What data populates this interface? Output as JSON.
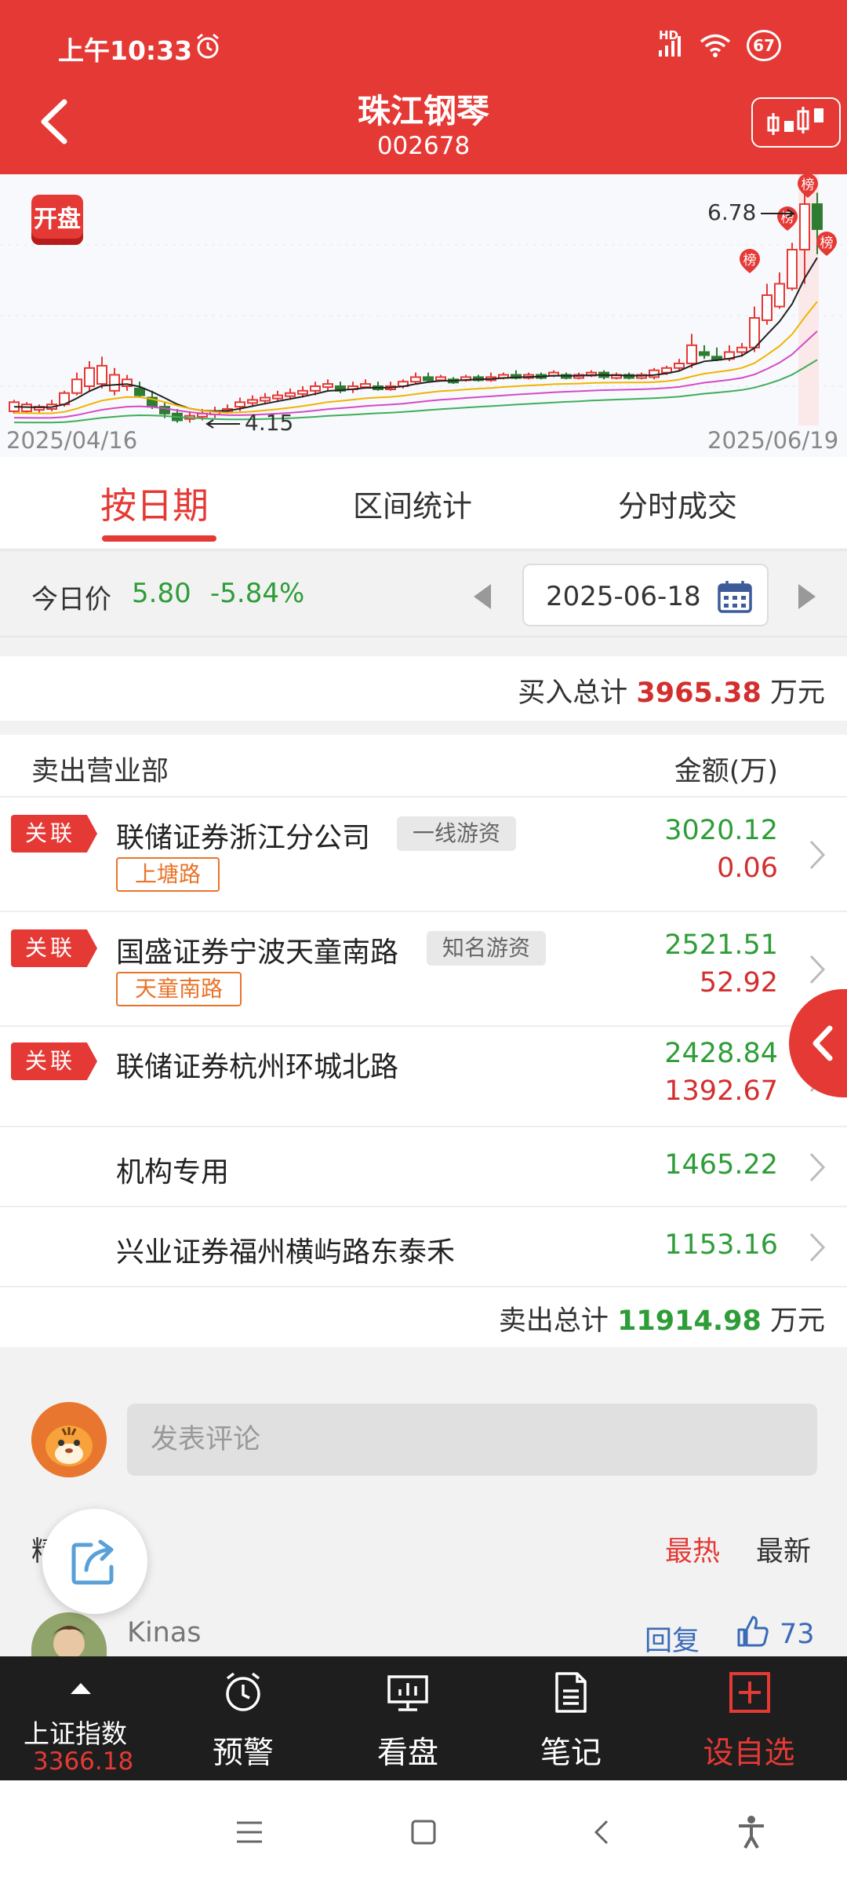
{
  "status_bar": {
    "time": "上午10:33",
    "network": "HD",
    "battery": "67"
  },
  "header": {
    "title": "珠江钢琴",
    "code": "002678"
  },
  "chart": {
    "logo": "开盘",
    "start_date": "2025/04/16",
    "end_date": "2025/06/19",
    "high_label": "6.78",
    "low_label": "4.15",
    "marker_label": "榜",
    "colors": {
      "up": "#e53935",
      "down": "#2e7d32",
      "ma5": "#222222",
      "ma10": "#f0b400",
      "ma20": "#d44ac7",
      "ma60": "#3fae5a"
    }
  },
  "tabs": [
    {
      "label": "按日期",
      "active": true
    },
    {
      "label": "区间统计",
      "active": false
    },
    {
      "label": "分时成交",
      "active": false
    }
  ],
  "price_row": {
    "label": "今日价",
    "price": "5.80",
    "change": "-5.84%",
    "date": "2025-06-18"
  },
  "buy_total": {
    "label": "买入总计",
    "value": "3965.38",
    "unit": "万元"
  },
  "sell": {
    "title": "卖出营业部",
    "amount_header": "金额(万)",
    "rows": [
      {
        "related": "关联",
        "name": "联储证券浙江分公司",
        "badge": "一线游资",
        "location": "上塘路",
        "sell": "3020.12",
        "buy": "0.06"
      },
      {
        "related": "关联",
        "name": "国盛证券宁波天童南路",
        "badge": "知名游资",
        "location": "天童南路",
        "sell": "2521.51",
        "buy": "52.92"
      },
      {
        "related": "关联",
        "name": "联储证券杭州环城北路",
        "sell": "2428.84",
        "buy": "1392.67"
      },
      {
        "name": "机构专用",
        "sell": "1465.22"
      },
      {
        "name": "兴业证券福州横屿路东泰禾",
        "sell": "1153.16"
      }
    ],
    "total_label": "卖出总计",
    "total_value": "11914.98",
    "total_unit": "万元"
  },
  "comments": {
    "input_placeholder": "发表评论",
    "section_label": "精彩评论",
    "sort_hot": "最热",
    "sort_new": "最新",
    "first_user": "Kinas",
    "reply_label": "回复",
    "like_count": "73"
  },
  "bottom_nav": {
    "index_name": "上证指数",
    "index_value": "3366.18",
    "alert": "预警",
    "market": "看盘",
    "notes": "笔记",
    "add_watch": "设自选"
  }
}
